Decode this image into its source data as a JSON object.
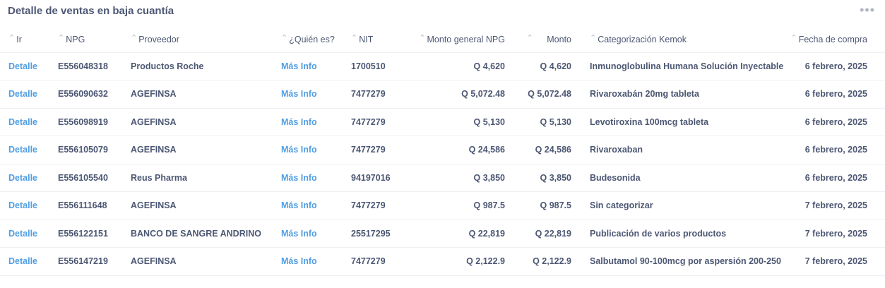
{
  "card": {
    "title": "Detalle de ventas en baja cuantía",
    "more_icon": "•••"
  },
  "table": {
    "sort_icon": "⌃",
    "columns": [
      "Ir",
      "NPG",
      "Proveedor",
      "¿Quién es?",
      "NIT",
      "Monto general NPG",
      "Monto",
      "Categorización Kemok",
      "Fecha de compra"
    ],
    "rows": [
      [
        "Detalle",
        "E556048318",
        "Productos Roche",
        "Más Info",
        "1700510",
        "Q 4,620",
        "Q 4,620",
        "Inmunoglobulina Humana Solución Inyectable",
        "6 febrero, 2025"
      ],
      [
        "Detalle",
        "E556090632",
        "AGEFINSA",
        "Más Info",
        "7477279",
        "Q 5,072.48",
        "Q 5,072.48",
        "Rivaroxabán 20mg tableta",
        "6 febrero, 2025"
      ],
      [
        "Detalle",
        "E556098919",
        "AGEFINSA",
        "Más Info",
        "7477279",
        "Q 5,130",
        "Q 5,130",
        "Levotiroxina 100mcg tableta",
        "6 febrero, 2025"
      ],
      [
        "Detalle",
        "E556105079",
        "AGEFINSA",
        "Más Info",
        "7477279",
        "Q 24,586",
        "Q 24,586",
        "Rivaroxaban",
        "6 febrero, 2025"
      ],
      [
        "Detalle",
        "E556105540",
        "Reus Pharma",
        "Más Info",
        "94197016",
        "Q 3,850",
        "Q 3,850",
        "Budesonida",
        "6 febrero, 2025"
      ],
      [
        "Detalle",
        "E556111648",
        "AGEFINSA",
        "Más Info",
        "7477279",
        "Q 987.5",
        "Q 987.5",
        "Sin categorizar",
        "7 febrero, 2025"
      ],
      [
        "Detalle",
        "E556122151",
        "BANCO DE SANGRE ANDRINO",
        "Más Info",
        "25517295",
        "Q 22,819",
        "Q 22,819",
        "Publicación de varios productos",
        "7 febrero, 2025"
      ],
      [
        "Detalle",
        "E556147219",
        "AGEFINSA",
        "Más Info",
        "7477279",
        "Q 2,122.9",
        "Q 2,122.9",
        "Salbutamol 90-100mcg por aspersión 200-250",
        "7 febrero, 2025"
      ]
    ]
  },
  "colors": {
    "text": "#4c5773",
    "link": "#509ee3",
    "divider": "#eef0f3"
  }
}
